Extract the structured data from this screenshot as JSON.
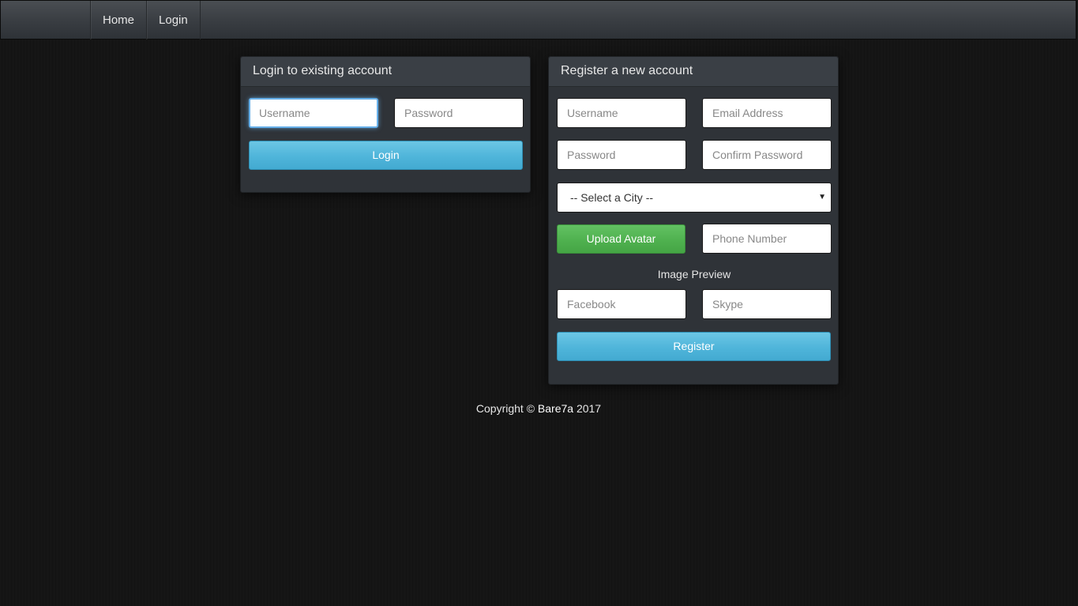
{
  "nav": {
    "items": [
      {
        "label": "Home"
      },
      {
        "label": "Login"
      }
    ]
  },
  "login_panel": {
    "title": "Login to existing account",
    "username_placeholder": "Username",
    "password_placeholder": "Password",
    "submit_label": "Login"
  },
  "register_panel": {
    "title": "Register a new account",
    "username_placeholder": "Username",
    "email_placeholder": "Email Address",
    "password_placeholder": "Password",
    "confirm_password_placeholder": "Confirm Password",
    "city_select_value": "-- Select a City --",
    "upload_avatar_label": "Upload Avatar",
    "phone_placeholder": "Phone Number",
    "image_preview_label": "Image Preview",
    "facebook_placeholder": "Facebook",
    "skype_placeholder": "Skype",
    "submit_label": "Register"
  },
  "footer": {
    "prefix": "Copyright ©",
    "brand": "Bare7a",
    "year": "2017"
  }
}
